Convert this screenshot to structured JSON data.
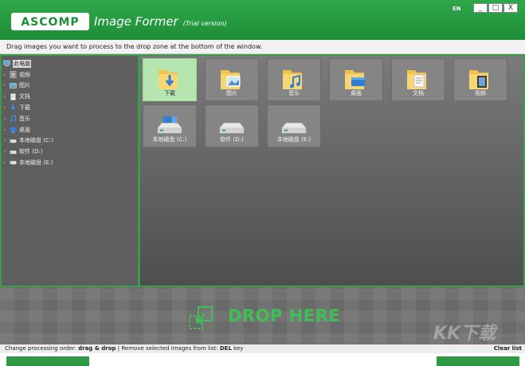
{
  "titlebar": {
    "logo_text": "ASCOMP",
    "title": "Image Former",
    "subtitle": "(Trial version)",
    "lang": "EN",
    "minimize": "_",
    "maximize": "□",
    "close": "X"
  },
  "hint": "Drag images you want to process to the drop zone at the bottom of the window.",
  "tree": {
    "root": "此电脑",
    "items": [
      {
        "label": "视频",
        "icon": "video-icon"
      },
      {
        "label": "图片",
        "icon": "picture-icon"
      },
      {
        "label": "文档",
        "icon": "document-icon"
      },
      {
        "label": "下载",
        "icon": "download-icon"
      },
      {
        "label": "音乐",
        "icon": "music-icon"
      },
      {
        "label": "桌面",
        "icon": "desktop-icon"
      },
      {
        "label": "本地磁盘 (C:)",
        "icon": "drive-icon"
      },
      {
        "label": "软件 (D:)",
        "icon": "drive-icon"
      },
      {
        "label": "本地磁盘 (E:)",
        "icon": "drive-icon"
      }
    ]
  },
  "tiles": [
    {
      "label": "下载",
      "icon": "download-folder-icon",
      "selected": true
    },
    {
      "label": "图片",
      "icon": "pictures-folder-icon"
    },
    {
      "label": "音乐",
      "icon": "music-folder-icon"
    },
    {
      "label": "桌面",
      "icon": "desktop-folder-icon"
    },
    {
      "label": "文档",
      "icon": "documents-folder-icon"
    },
    {
      "label": "视频",
      "icon": "videos-folder-icon"
    },
    {
      "label": "本地磁盘 (C:)",
      "icon": "drive-c-icon"
    },
    {
      "label": "软件 (D:)",
      "icon": "drive-icon"
    },
    {
      "label": "本地磁盘 (E:)",
      "icon": "drive-icon"
    }
  ],
  "dropzone": {
    "text": "DROP HERE",
    "watermark": "KK下载"
  },
  "status": {
    "order_prefix": "Change processing order: ",
    "order_value": "drag & drop",
    "separator": " | Remove selected images from list: ",
    "remove_value": "DEL",
    "remove_suffix": " key",
    "clear": "Clear list"
  },
  "colors": {
    "accent": "#2fa84a",
    "drop_text": "#3cbf55",
    "selected_tile": "#b6e6b0"
  }
}
